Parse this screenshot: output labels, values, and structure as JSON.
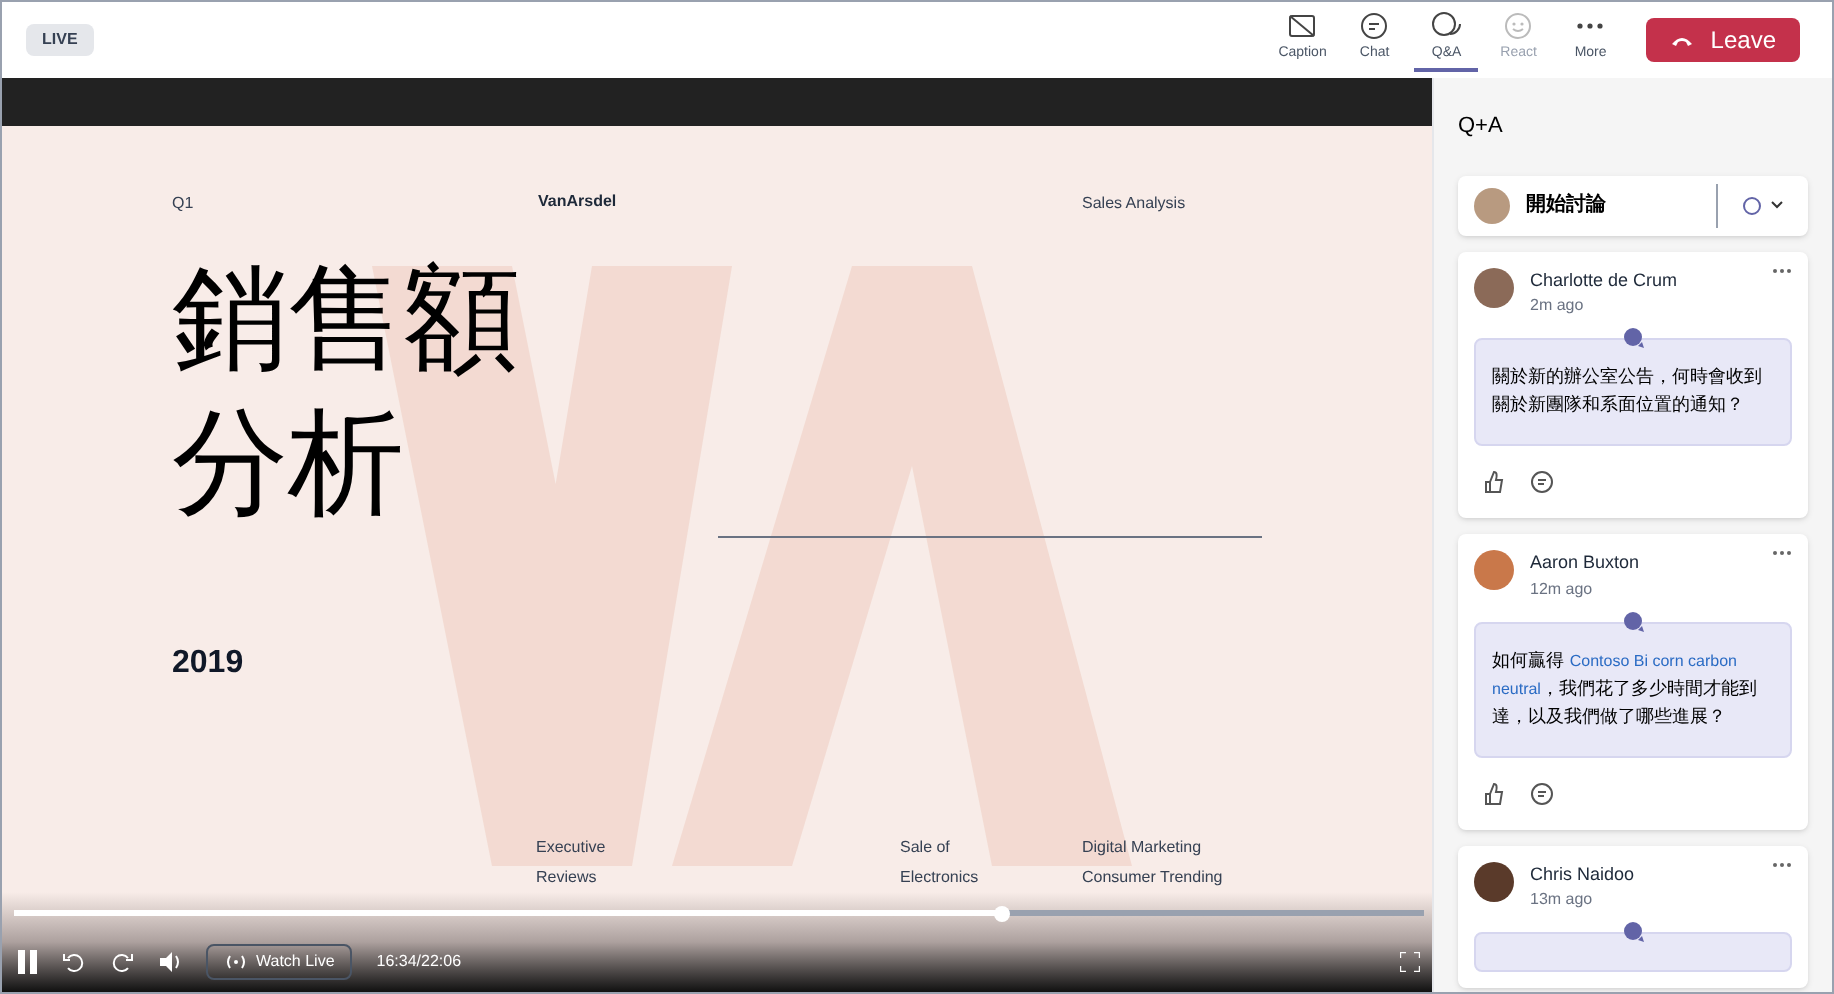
{
  "live_badge": "LIVE",
  "toolbar": [
    {
      "label": "Caption",
      "selected": false,
      "disabled": false
    },
    {
      "label": "Chat",
      "selected": false,
      "disabled": false
    },
    {
      "label": "Q&A",
      "selected": true,
      "disabled": false
    },
    {
      "label": "React",
      "selected": false,
      "disabled": true
    },
    {
      "label": "More",
      "selected": false,
      "disabled": false
    }
  ],
  "leave_button": "Leave",
  "slide": {
    "top_left": "Q1",
    "logo": "VanArsdel",
    "top_right": "Sales Analysis",
    "title_lines": [
      "銷售額",
      "分析"
    ],
    "year": "2019",
    "footer": [
      {
        "lines": [
          "Executive",
          "Reviews"
        ]
      },
      {
        "lines": [
          "Sale of",
          "Electronics"
        ]
      },
      {
        "lines": [
          "Digital Marketing",
          "Consumer Trending"
        ]
      }
    ]
  },
  "player": {
    "level": 0.7,
    "watch_live": "Watch Live",
    "time": "16:34/22:06"
  },
  "panel": {
    "title": "Q+A",
    "start_discussion": "開始討論",
    "questions": [
      {
        "author": "Charlotte de Crum",
        "time": "2m ago",
        "segments": [
          {
            "kind": "plain",
            "text": "關於新的辦公室公告，何時會收到關於新團隊和系面位置的通知？"
          }
        ]
      },
      {
        "author": "Aaron Buxton",
        "time": "12m ago",
        "segments": [
          {
            "kind": "plain",
            "text": "如何贏得 "
          },
          {
            "kind": "link",
            "text": "Contoso Bi corn carbon neutral"
          },
          {
            "kind": "plain",
            "text": "，我們花了多少時間才能到達，以及我們做了哪些進展？"
          }
        ]
      },
      {
        "author": "Chris Naidoo",
        "time": "13m ago"
      }
    ]
  }
}
